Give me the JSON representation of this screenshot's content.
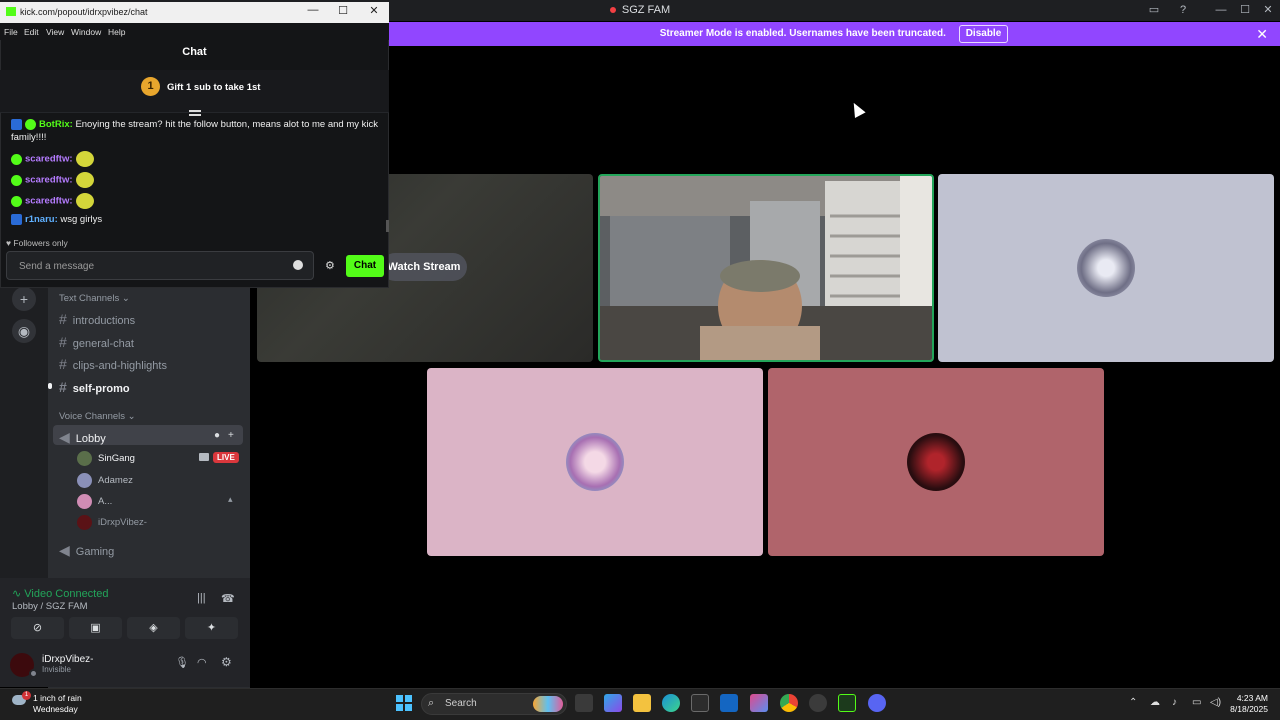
{
  "discord": {
    "window_title": "SGZ FAM",
    "banner_text": "Streamer Mode is enabled. Usernames have been truncated.",
    "banner_button": "Disable",
    "watch_stream": "Watch Stream",
    "categories": {
      "text": "Text Channels",
      "voice": "Voice Channels"
    },
    "text_channels": [
      "introductions",
      "general-chat",
      "clips-and-highlights",
      "self-promo"
    ],
    "voice_channels": [
      "Lobby",
      "Gaming"
    ],
    "members": [
      "SinGang",
      "Adamez",
      "A...",
      "iDrxpVibez-"
    ],
    "live_label": "LIVE",
    "voice_status": "Video Connected",
    "voice_location": "Lobby / SGZ FAM",
    "username": "iDrxpVibez-",
    "user_status": "Invisible"
  },
  "popout": {
    "url": "kick.com/popout/idrxpvibez/chat",
    "menu": [
      "File",
      "Edit",
      "View",
      "Window",
      "Help"
    ],
    "heading": "Chat",
    "pinned_rank": "1",
    "pinned_text": "Gift 1 sub to take 1st",
    "messages": [
      {
        "user": "BotRix",
        "text": "Enoying the stream? hit the follow button, means alot to me and my kick family!!!!",
        "color": "#53fc18"
      },
      {
        "user": "scaredftw",
        "text": "",
        "color": "#b57cff"
      },
      {
        "user": "scaredftw",
        "text": "",
        "color": "#b57cff"
      },
      {
        "user": "scaredftw",
        "text": "",
        "color": "#b57cff"
      },
      {
        "user": "r1naru",
        "text": "wsg girlys",
        "color": "#5fb0ff"
      }
    ],
    "followers_only": "Followers only",
    "input_placeholder": "Send a message",
    "send_label": "Chat"
  },
  "taskbar": {
    "weather_title": "1 inch of rain",
    "weather_sub": "Wednesday",
    "weather_badge": "1",
    "search_label": "Search",
    "time": "4:23 AM",
    "date": "8/18/2025"
  },
  "colors": {
    "kick_green": "#53fc18",
    "streamer_purple": "#9146ff",
    "discord_green": "#23a55a",
    "live_red": "#da373c"
  }
}
